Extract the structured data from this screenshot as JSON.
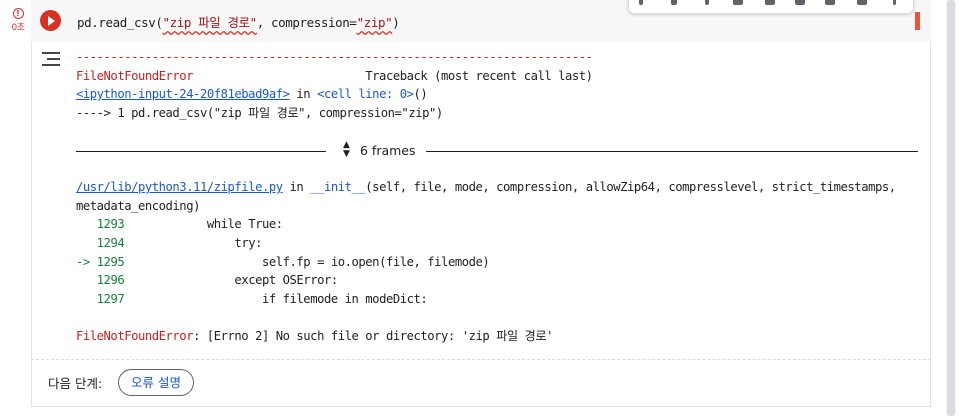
{
  "status": {
    "exec_time": "0초"
  },
  "cell": {
    "code_prefix": "pd.read_csv(",
    "code_arg": "\"zip 파일 경로\"",
    "code_mid": ", compression=",
    "code_arg2": "\"zip\"",
    "code_suffix": ")"
  },
  "output": {
    "dash_line": "---------------------------------------------------------------------------",
    "error_name": "FileNotFoundError",
    "traceback_header": "                         Traceback (most recent call last)",
    "input_link": "<ipython-input-24-20f81ebad9af>",
    "in_text": " in ",
    "cell_line": "<cell line: 0>",
    "cell_line_paren": "()",
    "arrow_line": "----> 1 pd.read_csv(\"zip 파일 경로\", compression=\"zip\")",
    "frames_label": "6 frames",
    "file_link": "/usr/lib/python3.11/zipfile.py",
    "init_in": " in ",
    "init_func": "__init__",
    "init_args": "(self, file, mode, compression, allowZip64, compresslevel, strict_timestamps,",
    "init_args2": "metadata_encoding)",
    "code_lines": [
      {
        "prefix": "   ",
        "num": "1293",
        "code": "            while True:"
      },
      {
        "prefix": "   ",
        "num": "1294",
        "code": "                try:"
      },
      {
        "prefix": "-> ",
        "num": "1295",
        "code": "                    self.fp = io.open(file, filemode)"
      },
      {
        "prefix": "   ",
        "num": "1296",
        "code": "                except OSError:"
      },
      {
        "prefix": "   ",
        "num": "1297",
        "code": "                    if filemode in modeDict:"
      }
    ],
    "final_error_name": "FileNotFoundError",
    "final_error_msg": ": [Errno 2] No such file or directory: 'zip 파일 경로'"
  },
  "next_steps": {
    "label": "다음 단계:",
    "explain_button": "오류 설명"
  },
  "colors": {
    "error_red": "#c5221f",
    "link_blue": "#1a57d6",
    "run_red": "#d93025"
  }
}
